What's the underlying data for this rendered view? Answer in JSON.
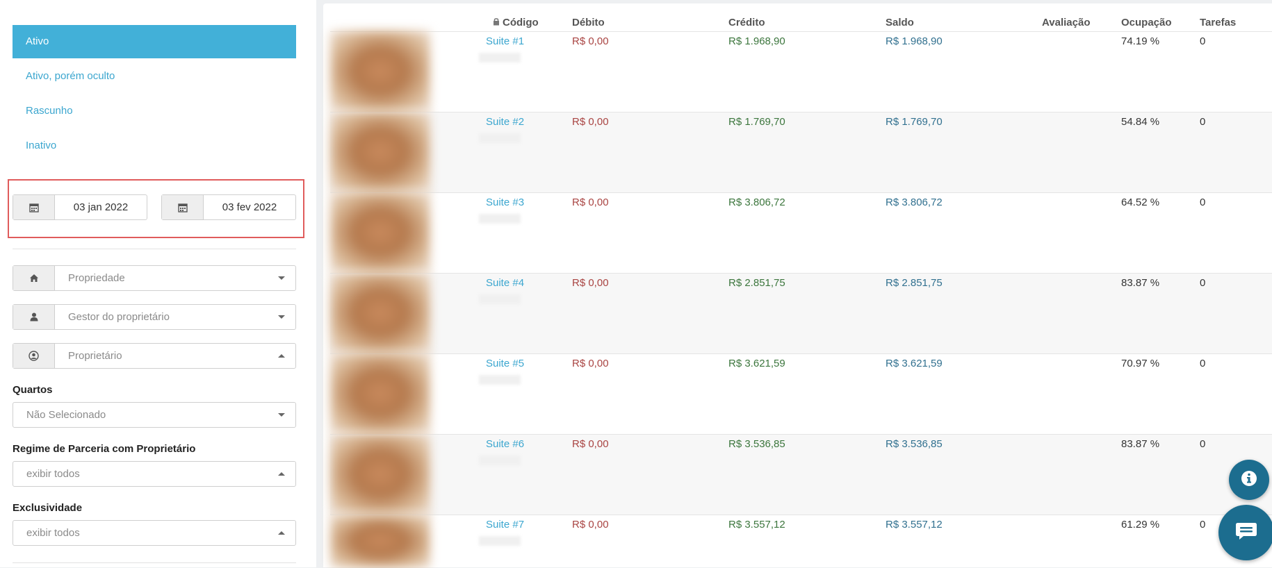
{
  "sidebar": {
    "status_items": [
      {
        "label": "Ativo",
        "active": true
      },
      {
        "label": "Ativo, porém oculto",
        "active": false
      },
      {
        "label": "Rascunho",
        "active": false
      },
      {
        "label": "Inativo",
        "active": false
      }
    ],
    "date_from": "03 jan 2022",
    "date_to": "03 fev 2022",
    "property_placeholder": "Propriedade",
    "owner_manager_placeholder": "Gestor do proprietário",
    "owner_placeholder": "Proprietário",
    "rooms_label": "Quartos",
    "rooms_value": "Não Selecionado",
    "partnership_label": "Regime de Parceria com Proprietário",
    "partnership_value": "exibir todos",
    "exclusivity_label": "Exclusividade",
    "exclusivity_value": "exibir todos"
  },
  "table": {
    "headers": {
      "code": "Código",
      "debit": "Débito",
      "credit": "Crédito",
      "balance": "Saldo",
      "rating": "Avaliação",
      "occupancy": "Ocupação",
      "tasks": "Tarefas"
    },
    "rows": [
      {
        "code": "Suite #1",
        "debit": "R$ 0,00",
        "credit": "R$ 1.968,90",
        "balance": "R$ 1.968,90",
        "occupancy": "74.19 %",
        "tasks": "0"
      },
      {
        "code": "Suite #2",
        "debit": "R$ 0,00",
        "credit": "R$ 1.769,70",
        "balance": "R$ 1.769,70",
        "occupancy": "54.84 %",
        "tasks": "0"
      },
      {
        "code": "Suite #3",
        "debit": "R$ 0,00",
        "credit": "R$ 3.806,72",
        "balance": "R$ 3.806,72",
        "occupancy": "64.52 %",
        "tasks": "0"
      },
      {
        "code": "Suite #4",
        "debit": "R$ 0,00",
        "credit": "R$ 2.851,75",
        "balance": "R$ 2.851,75",
        "occupancy": "83.87 %",
        "tasks": "0"
      },
      {
        "code": "Suite #5",
        "debit": "R$ 0,00",
        "credit": "R$ 3.621,59",
        "balance": "R$ 3.621,59",
        "occupancy": "70.97 %",
        "tasks": "0"
      },
      {
        "code": "Suite #6",
        "debit": "R$ 0,00",
        "credit": "R$ 3.536,85",
        "balance": "R$ 3.536,85",
        "occupancy": "83.87 %",
        "tasks": "0"
      },
      {
        "code": "Suite #7",
        "debit": "R$ 0,00",
        "credit": "R$ 3.557,12",
        "balance": "R$ 3.557,12",
        "occupancy": "61.29 %",
        "tasks": "0"
      }
    ]
  },
  "colors": {
    "accent": "#42b0d8",
    "link": "#3ba6cf",
    "debit": "#a94442",
    "credit": "#3c763d",
    "balance": "#31708f",
    "highlight": "#e05b5b",
    "fab": "#1c6d8f"
  },
  "icons": [
    "calendar-icon",
    "home-icon",
    "user-icon",
    "user-circle-icon",
    "lock-icon",
    "info-icon",
    "chat-icon"
  ]
}
